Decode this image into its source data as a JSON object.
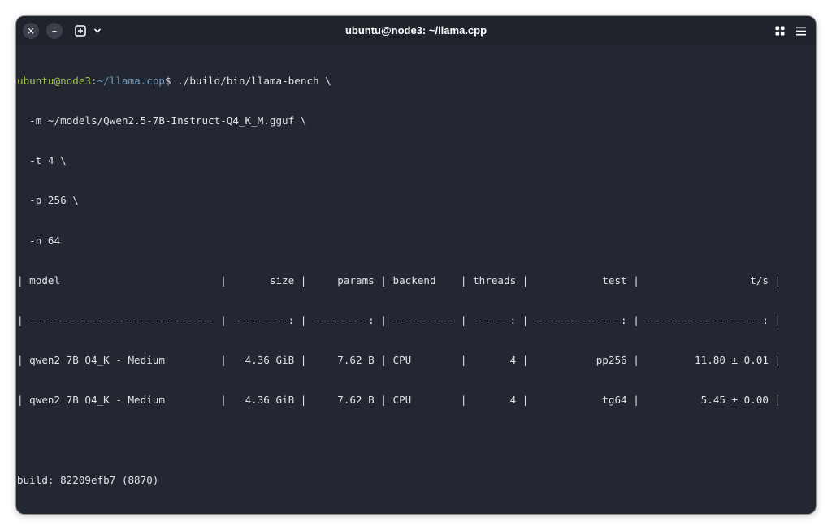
{
  "window": {
    "title": "ubuntu@node3: ~/llama.cpp"
  },
  "titlebar": {
    "close_glyph": "×",
    "minimize_glyph": "–"
  },
  "prompt": {
    "user_host": "ubuntu@node3",
    "separator": ":",
    "path": "~/llama.cpp",
    "symbol": "$"
  },
  "terminal": {
    "command_first": " ./build/bin/llama-bench \\",
    "command_args": [
      "  -m ~/models/Qwen2.5-7B-Instruct-Q4_K_M.gguf \\",
      "  -t 4 \\",
      "  -p 256 \\",
      "  -n 64"
    ],
    "table_header": "| model                          |       size |     params | backend    | threads |            test |                  t/s |",
    "table_separator": "| ------------------------------ | ---------: | ---------: | ---------- | ------: | --------------: | -------------------: |",
    "table_rows": [
      "| qwen2 7B Q4_K - Medium         |   4.36 GiB |     7.62 B | CPU        |       4 |           pp256 |         11.80 ± 0.01 |",
      "| qwen2 7B Q4_K - Medium         |   4.36 GiB |     7.62 B | CPU        |       4 |            tg64 |          5.45 ± 0.00 |"
    ],
    "build_line": "build: 82209efb7 (8870)"
  },
  "icons": {
    "close": "close-icon",
    "minimize": "minimize-icon",
    "new_tab": "new-tab-icon",
    "tab_menu": "chevron-down-icon",
    "view_grid": "grid-icon",
    "main_menu": "hamburger-menu-icon"
  },
  "colors": {
    "background": "#232731",
    "titlebar": "#1f232b",
    "text": "#dfe2e7",
    "prompt_user": "#a6c54b",
    "prompt_path": "#6e9cc4"
  }
}
